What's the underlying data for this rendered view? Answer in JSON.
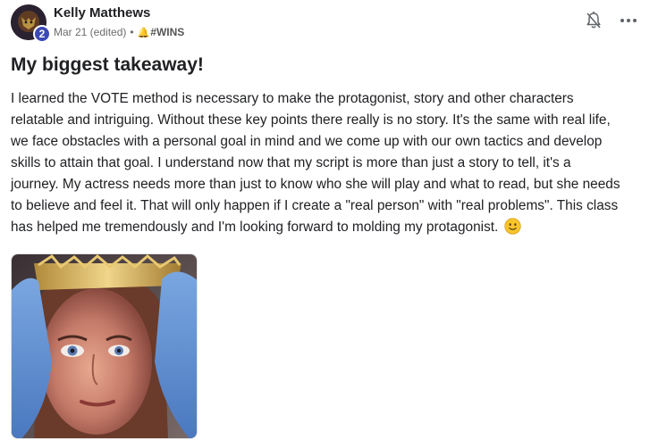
{
  "post": {
    "author": "Kelly Matthews",
    "level": "2",
    "date": "Mar 21 (edited)",
    "separator": "•",
    "category_emoji": "🔔",
    "category": "#WINS",
    "title": "My biggest takeaway!",
    "body_lines": [
      "I learned the VOTE method is necessary to make the protagonist, story and other characters",
      "relatable and intriguing. Without these key points there really is no story. It's the same with real life,",
      "we face obstacles with a personal goal in mind and we come up with our own tactics and develop",
      "skills to attain that goal. I understand now that my script is more than just a story to tell, it's a",
      "journey. My actress needs more than just to know who she will play and what to read, but she needs",
      "to believe and feel it. That will only happen if I create a \"real person\" with \"real problems\". This class",
      "has helped me tremendously and I'm looking forward to molding my protagonist."
    ],
    "icons": {
      "notification": "bell-off-icon",
      "more": "more-horizontal-icon",
      "emoji": "slightly-smiling-face-icon"
    },
    "colors": {
      "level_badge": "#3b4ab5",
      "text": "#202124",
      "meta": "#6b6b6b"
    }
  }
}
